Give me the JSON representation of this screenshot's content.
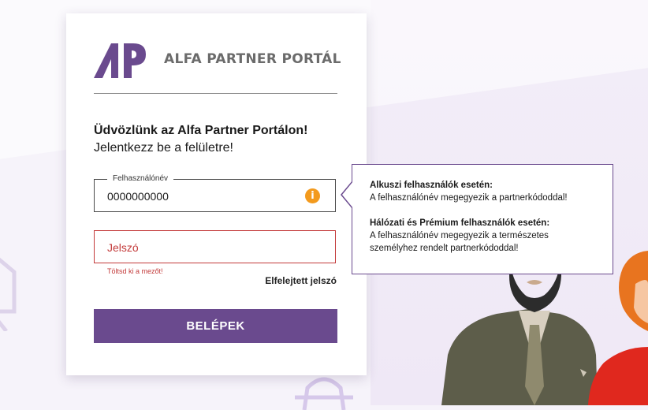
{
  "brand": {
    "name": "ALFA PARTNER PORTÁL",
    "primary_color": "#6a4a8e",
    "accent_color": "#f39a1d",
    "error_color": "#c33a3a"
  },
  "greeting": {
    "title": "Üdvözlünk az Alfa Partner Portálon!",
    "subtitle": "Jelentkezz be a felületre!"
  },
  "username": {
    "label": "Felhasználónév",
    "value": "0000000000",
    "info_icon": "info-icon"
  },
  "password": {
    "placeholder": "Jelszó",
    "error": "Töltsd ki a mezőt!"
  },
  "forgot_password": "Elfelejtett jelszó",
  "login_button": "BELÉPEK",
  "tooltip": {
    "broker_title": "Alkuszi felhasználók esetén:",
    "broker_text": "A felhasználónév megegyezik a partnerkódoddal!",
    "network_title": "Hálózati és Prémium felhasználók esetén:",
    "network_text": "A felhasználónév megegyezik a természetes személyhez rendelt partnerkódoddal!"
  }
}
